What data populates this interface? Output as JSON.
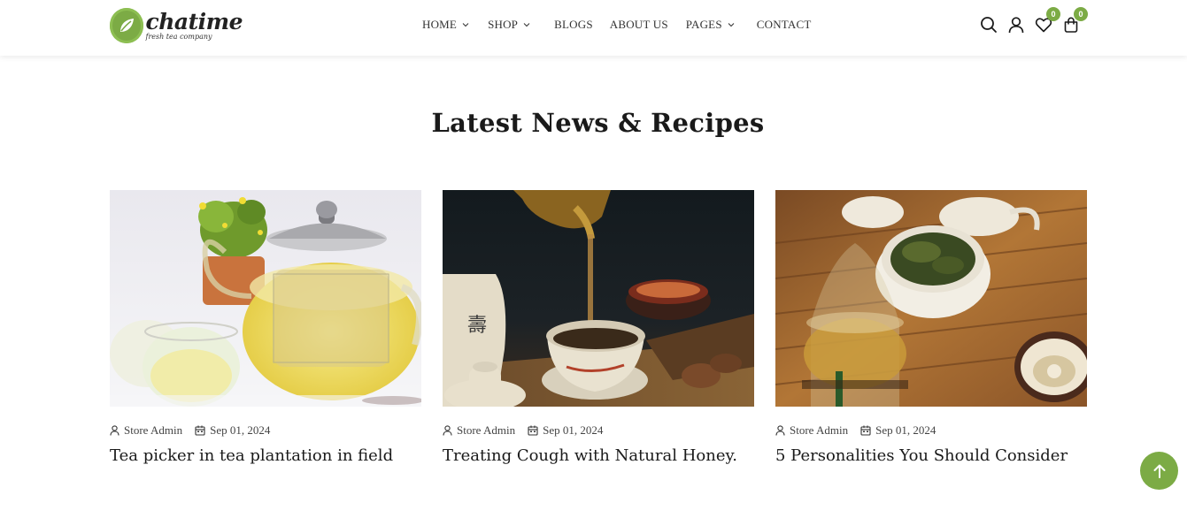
{
  "brand": {
    "name": "chatime",
    "tagline": "fresh tea company",
    "accent_color": "#7cab45"
  },
  "nav": {
    "items": [
      {
        "label": "HOME",
        "has_dropdown": true
      },
      {
        "label": "SHOP",
        "has_dropdown": true
      },
      {
        "label": "BLOGS",
        "has_dropdown": false
      },
      {
        "label": "ABOUT US",
        "has_dropdown": false
      },
      {
        "label": "PAGES",
        "has_dropdown": true
      },
      {
        "label": "CONTACT",
        "has_dropdown": false
      }
    ]
  },
  "header_icons": {
    "search": "search-icon",
    "account": "user-icon",
    "wishlist": {
      "icon": "heart-icon",
      "count": "0"
    },
    "cart": {
      "icon": "bag-icon",
      "count": "0"
    }
  },
  "section": {
    "title": "Latest News & Recipes"
  },
  "posts": [
    {
      "author": "Store Admin",
      "date": "Sep 01, 2024",
      "title": "Tea picker in tea plantation in field",
      "image": "glass-teapot-photo"
    },
    {
      "author": "Store Admin",
      "date": "Sep 01, 2024",
      "title": "Treating Cough with Natural Honey.",
      "image": "pouring-tea-photo"
    },
    {
      "author": "Store Admin",
      "date": "Sep 01, 2024",
      "title": "5 Personalities You Should Consider",
      "image": "tea-set-tray-photo"
    }
  ],
  "scroll_top": {
    "icon": "arrow-up-icon"
  }
}
